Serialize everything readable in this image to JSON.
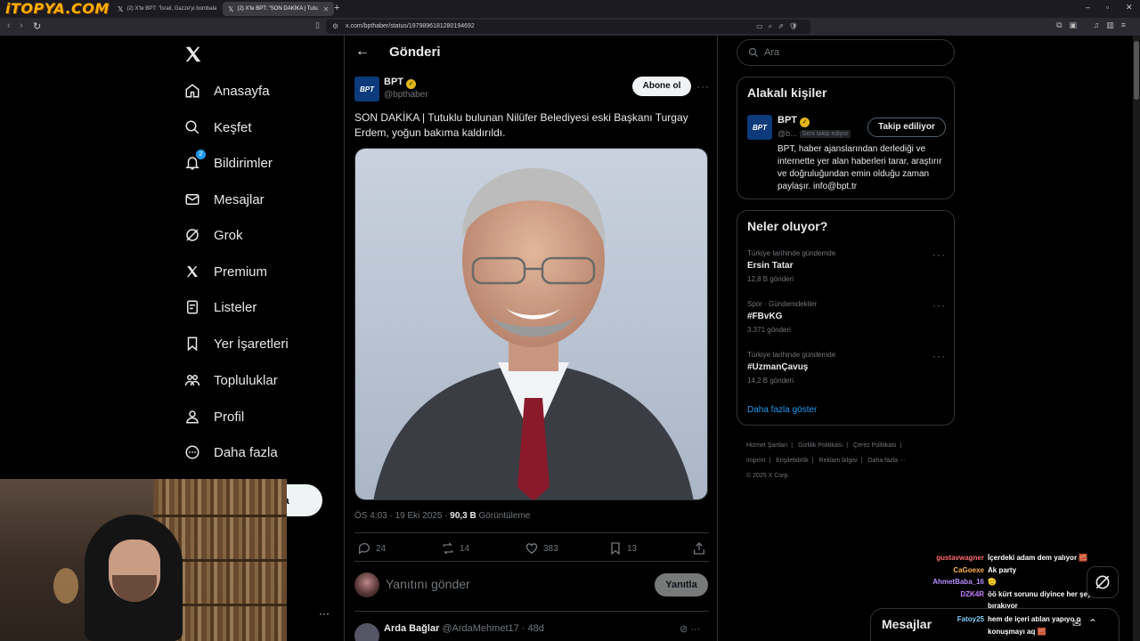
{
  "overlay_logo": "iTOPYA.COM",
  "browser": {
    "tabs": [
      {
        "label": "(2) X'te BPT: \"İsrail, Gazze'yi bombala"
      },
      {
        "label": "(2) X'te BPT: \"SON DAKİKA | Tutu"
      }
    ],
    "url": "x.com/bpthaber/status/1979896181280194692"
  },
  "sidebar": {
    "items": [
      {
        "label": "Anasayfa",
        "icon": "home-icon"
      },
      {
        "label": "Keşfet",
        "icon": "search-icon"
      },
      {
        "label": "Bildirimler",
        "icon": "bell-icon",
        "badge": "2"
      },
      {
        "label": "Mesajlar",
        "icon": "mail-icon"
      },
      {
        "label": "Grok",
        "icon": "grok-icon"
      },
      {
        "label": "Premium",
        "icon": "x-icon"
      },
      {
        "label": "Listeler",
        "icon": "list-icon"
      },
      {
        "label": "Yer İşaretleri",
        "icon": "bookmark-icon"
      },
      {
        "label": "Topluluklar",
        "icon": "communities-icon"
      },
      {
        "label": "Profil",
        "icon": "person-icon"
      },
      {
        "label": "Daha fazla",
        "icon": "more-icon"
      }
    ],
    "post_button_partial": "a"
  },
  "main": {
    "title": "Gönderi",
    "tweet": {
      "author_name": "BPT",
      "author_handle": "@bpthaber",
      "avatar_text": "BPT",
      "subscribe_label": "Abone ol",
      "text": "SON DAKİKA | Tutuklu bulunan Nilüfer Belediyesi eski Başkanı Turgay Erdem, yoğun bakıma kaldırıldı.",
      "time": "ÖS 4:03 · 19 Eki 2025 · ",
      "views": "90,3 B",
      "views_label": " Görüntüleme",
      "replies": "24",
      "reposts": "14",
      "likes": "383",
      "bookmarks": "13"
    },
    "reply_placeholder": "Yanıtını gönder",
    "reply_button": "Yanıtla",
    "next_reply": {
      "name": "Arda Bağlar",
      "handle": "@ArdaMehmet17 · 48d"
    }
  },
  "right": {
    "search_placeholder": "Ara",
    "related": {
      "title": "Alakalı kişiler",
      "name": "BPT",
      "handle": "@b...",
      "follows_you": "Seni takip ediyor",
      "following_label": "Takip ediliyor",
      "bio": "BPT, haber ajanslarından derlediği ve internette yer alan haberleri tarar, araştırır ve doğruluğundan emin olduğu zaman paylaşır. info@bpt.tr"
    },
    "trends": {
      "title": "Neler oluyor?",
      "items": [
        {
          "category": "Türkiye tarihinde gündemde",
          "name": "Ersin Tatar",
          "count": "12,8 B gönderi"
        },
        {
          "category": "Spor · Gündemdekiler",
          "name": "#FBvKG",
          "count": "3.371 gönderi"
        },
        {
          "category": "Türkiye tarihinde gündemde",
          "name": "#UzmanÇavuş",
          "count": "14,2 B gönderi"
        }
      ],
      "show_more": "Daha fazla göster"
    },
    "footer": [
      "Hizmet Şartları",
      "|",
      "Gizlilik Politikası",
      "|",
      "Çerez Politikası",
      "|",
      "Imprint",
      "|",
      "Erişilebilirlik",
      "|",
      "Reklam bilgisi",
      "|",
      "Daha fazla ···",
      "© 2025 X Corp."
    ]
  },
  "chat": [
    {
      "user": "gustavwagner",
      "color": "#ff6b6b",
      "msg": "İçerdeki adam dem yalıyor 🧱"
    },
    {
      "user": "CaGoexe",
      "color": "#ffb347",
      "msg": "Ak party"
    },
    {
      "user": "AhmetBaba_16",
      "color": "#b48cff",
      "msg": "🫡"
    },
    {
      "user": "DZK4R",
      "color": "#c77dff",
      "msg": "öö kürt sorunu diyince her şeyi",
      "msg2": "bırakıyor"
    },
    {
      "user": "Fatoy25",
      "color": "#7fd0ff",
      "msg": "hem de içeri atılan yapıyo o",
      "msg2": "konuşmayı aq 🧱"
    }
  ],
  "messages": {
    "title": "Mesajlar"
  }
}
